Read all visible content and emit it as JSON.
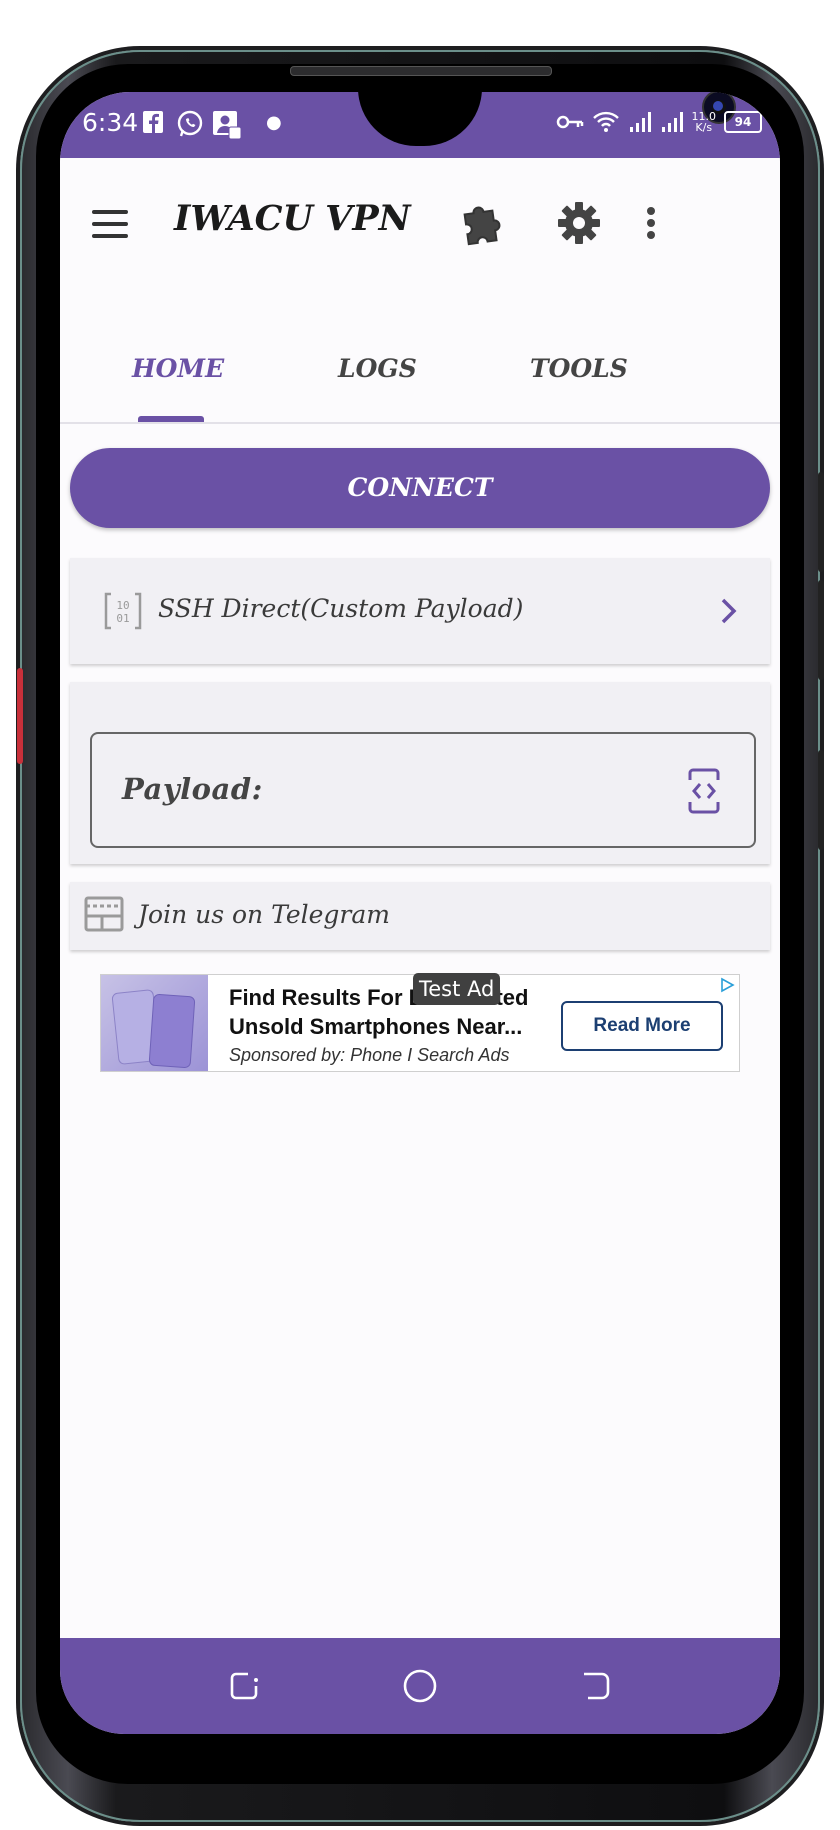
{
  "status_bar": {
    "time": "6:34",
    "left_icons": [
      "facebook-icon",
      "whatsapp-icon",
      "contact-icon",
      "dot-icon"
    ],
    "right_icons": [
      "vpn-key-icon",
      "wifi-icon",
      "signal-icon",
      "signal-icon"
    ],
    "speed_value": "11.0",
    "speed_unit": "K/s",
    "battery": "94"
  },
  "app": {
    "title": "IWACU VPN",
    "actions": [
      "plugin-icon",
      "settings-gear-icon",
      "more-vert-icon"
    ]
  },
  "tabs": [
    {
      "label": "HOME",
      "active": true
    },
    {
      "label": "LOGS",
      "active": false
    },
    {
      "label": "TOOLS",
      "active": false
    }
  ],
  "connect_label": "CONNECT",
  "mode": {
    "label": "SSH Direct(Custom Payload)",
    "icon": "binary-icon"
  },
  "payload": {
    "label": "Payload:"
  },
  "telegram": {
    "label": "Join us on Telegram"
  },
  "ad": {
    "badge": "Test Ad",
    "title_line1": "Find Results For Discounted",
    "title_line2": "Unsold Smartphones Near...",
    "sponsor": "Sponsored by: Phone I Search Ads",
    "button": "Read More"
  },
  "colors": {
    "accent": "#6a51a5",
    "background": "#fcfbfd",
    "card": "#f1f0f4"
  }
}
